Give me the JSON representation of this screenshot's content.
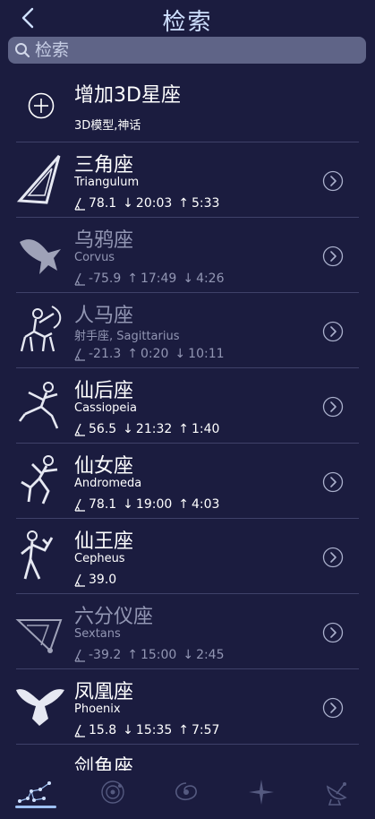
{
  "header": {
    "title": "检索",
    "back_icon": "chevron-left-icon"
  },
  "search": {
    "placeholder": "检索",
    "icon": "search-icon"
  },
  "add_item": {
    "title": "增加3D星座",
    "subtitle": "3D模型,神话",
    "icon": "plus-circle-icon"
  },
  "constellations": [
    {
      "name": "三角座",
      "latin": "Triangulum",
      "altitude": "78.1",
      "first_arrow": "↓",
      "first_time": "20:03",
      "second_arrow": "↑",
      "second_time": "5:33",
      "dim": false,
      "icon": "triangulum-figure-icon"
    },
    {
      "name": "乌鸦座",
      "latin": "Corvus",
      "altitude": "-75.9",
      "first_arrow": "↑",
      "first_time": "17:49",
      "second_arrow": "↓",
      "second_time": "4:26",
      "dim": true,
      "icon": "corvus-figure-icon"
    },
    {
      "name": "人马座",
      "latin": "射手座, Sagittarius",
      "altitude": "-21.3",
      "first_arrow": "↑",
      "first_time": "0:20",
      "second_arrow": "↓",
      "second_time": "10:11",
      "dim": true,
      "icon": "sagittarius-figure-icon"
    },
    {
      "name": "仙后座",
      "latin": "Cassiopeia",
      "altitude": "56.5",
      "first_arrow": "↓",
      "first_time": "21:32",
      "second_arrow": "↑",
      "second_time": "1:40",
      "dim": false,
      "icon": "cassiopeia-figure-icon"
    },
    {
      "name": "仙女座",
      "latin": "Andromeda",
      "altitude": "78.1",
      "first_arrow": "↓",
      "first_time": "19:00",
      "second_arrow": "↑",
      "second_time": "4:03",
      "dim": false,
      "icon": "andromeda-figure-icon"
    },
    {
      "name": "仙王座",
      "latin": "Cepheus",
      "altitude": "39.0",
      "first_arrow": "",
      "first_time": "",
      "second_arrow": "",
      "second_time": "",
      "dim": false,
      "icon": "cepheus-figure-icon"
    },
    {
      "name": "六分仪座",
      "latin": "Sextans",
      "altitude": "-39.2",
      "first_arrow": "↑",
      "first_time": "15:00",
      "second_arrow": "↓",
      "second_time": "2:45",
      "dim": true,
      "icon": "sextans-figure-icon"
    },
    {
      "name": "凤凰座",
      "latin": "Phoenix",
      "altitude": "15.8",
      "first_arrow": "↓",
      "first_time": "15:35",
      "second_arrow": "↑",
      "second_time": "7:57",
      "dim": false,
      "icon": "phoenix-figure-icon"
    },
    {
      "name": "剑鱼座",
      "latin": "",
      "altitude": "",
      "first_arrow": "",
      "first_time": "",
      "second_arrow": "",
      "second_time": "",
      "dim": false,
      "icon": "dorado-figure-icon"
    }
  ],
  "tabs": [
    {
      "icon": "constellation-icon",
      "active": true
    },
    {
      "icon": "planet-icon",
      "active": false
    },
    {
      "icon": "galaxy-icon",
      "active": false
    },
    {
      "icon": "star-icon",
      "active": false
    },
    {
      "icon": "satellite-dish-icon",
      "active": false
    }
  ],
  "colors": {
    "background": "#1b1c3f",
    "title": "#cfe0ff",
    "search_bg": "#5f6487",
    "dim_text": "#9296b3",
    "divider": "#3f4169",
    "tab_active": "#9dbff2"
  }
}
